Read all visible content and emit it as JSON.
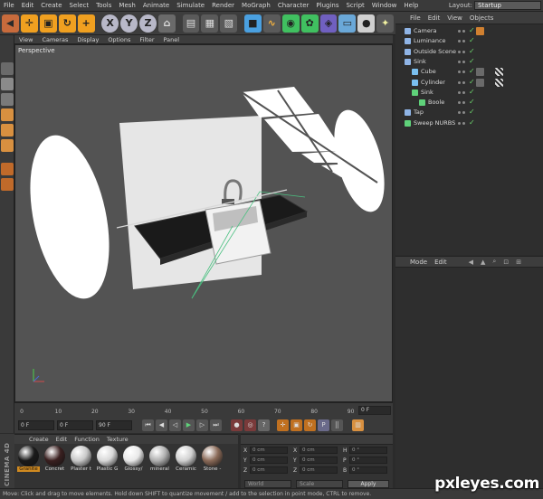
{
  "menubar": {
    "items": [
      "File",
      "Edit",
      "Create",
      "Select",
      "Tools",
      "Mesh",
      "Animate",
      "Simulate",
      "Render",
      "MoGraph",
      "Character",
      "Plugins",
      "Script",
      "Window",
      "Help"
    ],
    "layout_label": "Layout:",
    "layout_value": "Startup"
  },
  "toolbar": {
    "tools": [
      "undo",
      "move",
      "scale",
      "rotate",
      "move-cross",
      "x-axis",
      "y-axis",
      "z-axis",
      "coord-system",
      "render-view",
      "render-picture",
      "render-settings",
      "cube",
      "spline",
      "nurbs",
      "array",
      "deformer",
      "floor",
      "camera",
      "light"
    ],
    "axis_labels": [
      "X",
      "Y",
      "Z"
    ]
  },
  "viewport": {
    "menu": [
      "View",
      "Cameras",
      "Display",
      "Options",
      "Filter",
      "Panel"
    ],
    "label": "Perspective"
  },
  "timeline": {
    "ticks": [
      "0",
      "10",
      "20",
      "30",
      "40",
      "50",
      "60",
      "70",
      "80",
      "90"
    ],
    "frame_field": "0 F"
  },
  "transport": {
    "start": "0 F",
    "current": "0 F",
    "end": "90 F"
  },
  "object_manager": {
    "menu": [
      "File",
      "Edit",
      "View",
      "Objects"
    ],
    "objects": [
      {
        "name": "Camera",
        "depth": 0,
        "color": "#8fb4e6"
      },
      {
        "name": "Luminance",
        "depth": 0,
        "color": "#8fb4e6"
      },
      {
        "name": "Outside Scene",
        "depth": 0,
        "color": "#8fb4e6"
      },
      {
        "name": "Sink",
        "depth": 0,
        "color": "#8fb4e6"
      },
      {
        "name": "Cube",
        "depth": 1,
        "color": "#7ac0f0"
      },
      {
        "name": "Cylinder",
        "depth": 1,
        "color": "#7ac0f0"
      },
      {
        "name": "Sink",
        "depth": 1,
        "color": "#5fd27a"
      },
      {
        "name": "Boole",
        "depth": 2,
        "color": "#5fd27a"
      },
      {
        "name": "Tap",
        "depth": 0,
        "color": "#8fb4e6"
      },
      {
        "name": "Sweep NURBS",
        "depth": 0,
        "color": "#5fd27a"
      }
    ]
  },
  "attribute_manager": {
    "menu": [
      "Mode",
      "Edit"
    ]
  },
  "material_manager": {
    "menu": [
      "Create",
      "Edit",
      "Function",
      "Texture"
    ],
    "materials": [
      {
        "name": "Granite",
        "color": "#1a1a1a"
      },
      {
        "name": "Concret",
        "color": "#3a2020"
      },
      {
        "name": "Plaster t",
        "color": "#c8c8c8"
      },
      {
        "name": "Plastic G",
        "color": "#d8d8d8"
      },
      {
        "name": "Glossy/",
        "color": "#e8e8e8"
      },
      {
        "name": "mineral",
        "color": "#b0b0b0"
      },
      {
        "name": "Ceramic",
        "color": "#d0d0d0"
      },
      {
        "name": "Stone -",
        "color": "#8a6a58"
      }
    ]
  },
  "coordinates": {
    "fields": [
      "0 cm",
      "0 cm",
      "0 cm",
      "0 cm",
      "0 cm",
      "0 cm",
      "0 °",
      "0 °",
      "0 °"
    ],
    "labels": [
      "X",
      "Y",
      "Z",
      "X",
      "Y",
      "Z",
      "H",
      "P",
      "B"
    ],
    "mode1": "World",
    "mode2": "Scale",
    "apply": "Apply"
  },
  "sidebar_brand": "CINEMA 4D",
  "statusbar": {
    "text": "Move: Click and drag to move elements. Hold down SHIFT to quantize movement / add to the selection in point mode, CTRL to remove."
  },
  "watermark": "pxleyes.com",
  "colors": {
    "viewport_bg": "#535353",
    "panel_bg": "#2e2e2e",
    "axis_x": "#d14b4b",
    "axis_y": "#4bd14b",
    "axis_z": "#4b6bd1"
  }
}
